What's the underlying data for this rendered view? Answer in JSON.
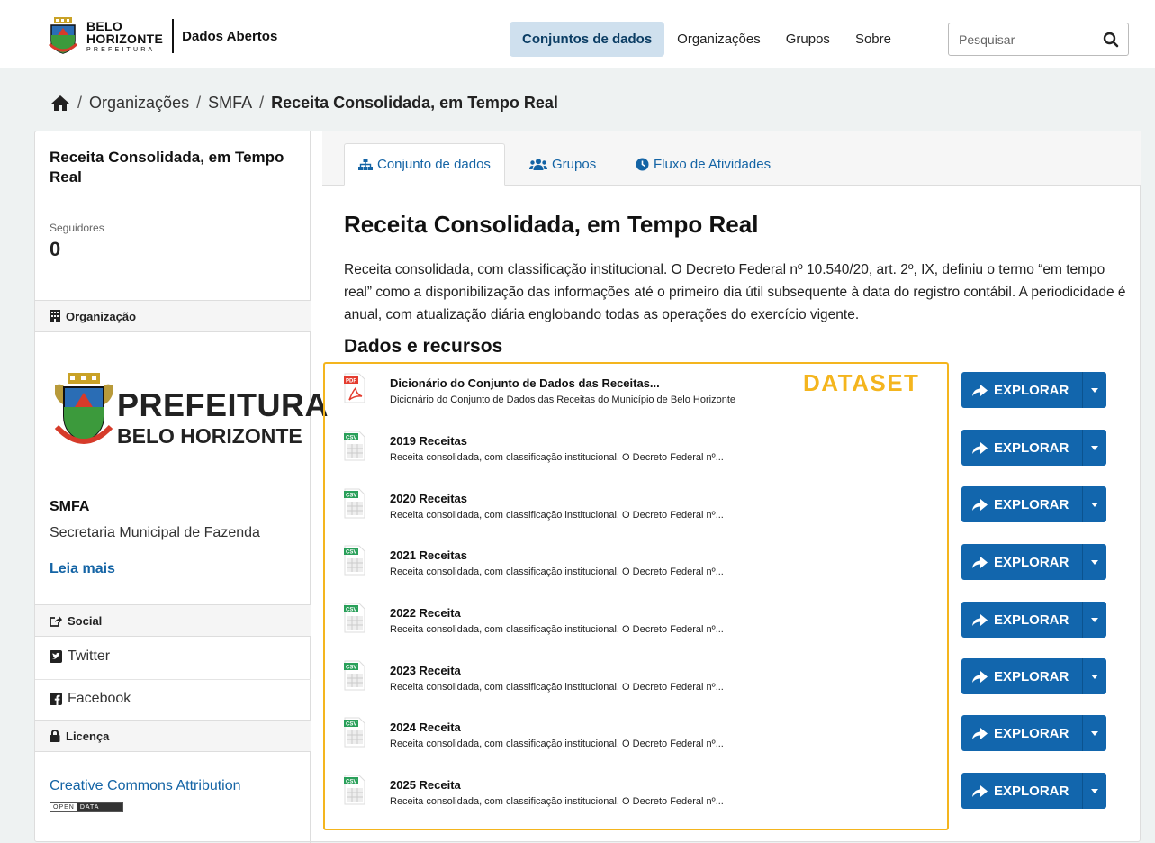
{
  "header": {
    "logo_line1": "BELO",
    "logo_line2": "HORIZONTE",
    "logo_line3": "PREFEITURA",
    "logo_sub": "Dados Abertos",
    "nav": [
      {
        "label": "Conjuntos de dados",
        "active": true
      },
      {
        "label": "Organizações"
      },
      {
        "label": "Grupos"
      },
      {
        "label": "Sobre"
      }
    ],
    "search_placeholder": "Pesquisar"
  },
  "breadcrumb": {
    "items": [
      "Organizações",
      "SMFA"
    ],
    "current": "Receita Consolidada, em Tempo Real",
    "sep": "/"
  },
  "sidebar": {
    "title": "Receita Consolidada, em Tempo Real",
    "followers_label": "Seguidores",
    "followers_count": "0",
    "org_section": "Organização",
    "org_logo_word1": "PREFEITURA",
    "org_logo_word2": "BELO HORIZONTE",
    "org_name": "SMFA",
    "org_desc": "Secretaria Municipal de Fazenda",
    "read_more": "Leia mais",
    "social_section": "Social",
    "twitter": "Twitter",
    "facebook": "Facebook",
    "license_section": "Licença",
    "license_link": "Creative Commons Attribution",
    "badge_open": "OPEN",
    "badge_data": "DATA"
  },
  "tabs": [
    {
      "label": "Conjunto de dados",
      "active": true
    },
    {
      "label": "Grupos"
    },
    {
      "label": "Fluxo de Atividades"
    }
  ],
  "dataset": {
    "title": "Receita Consolidada, em Tempo Real",
    "description": "Receita consolidada, com classificação institucional. O Decreto Federal nº 10.540/20, art. 2º, IX, definiu o termo “em tempo real” como a disponibilização das informações até o primeiro dia útil subsequente à data do registro contábil. A periodicidade é anual, com atualização diária englobando todas as operações do exercício vigente.",
    "resources_heading": "Dados e recursos",
    "annotation": "DATASET",
    "explore_label": "EXPLORAR",
    "resources": [
      {
        "format": "PDF",
        "name": "Dicionário do Conjunto de Dados das Receitas...",
        "desc": "Dicionário do Conjunto de Dados das Receitas do Município de Belo Horizonte"
      },
      {
        "format": "CSV",
        "name": "2019 Receitas",
        "desc": "Receita consolidada, com classificação institucional. O Decreto Federal nº..."
      },
      {
        "format": "CSV",
        "name": "2020 Receitas",
        "desc": "Receita consolidada, com classificação institucional. O Decreto Federal nº..."
      },
      {
        "format": "CSV",
        "name": "2021 Receitas",
        "desc": "Receita consolidada, com classificação institucional. O Decreto Federal nº..."
      },
      {
        "format": "CSV",
        "name": "2022 Receita",
        "desc": "Receita consolidada, com classificação institucional. O Decreto Federal nº..."
      },
      {
        "format": "CSV",
        "name": "2023 Receita",
        "desc": "Receita consolidada, com classificação institucional. O Decreto Federal nº..."
      },
      {
        "format": "CSV",
        "name": "2024 Receita",
        "desc": "Receita consolidada, com classificação institucional. O Decreto Federal nº..."
      },
      {
        "format": "CSV",
        "name": "2025 Receita",
        "desc": "Receita consolidada, com classificação institucional. O Decreto Federal nº..."
      }
    ]
  },
  "colors": {
    "accent": "#1266ad",
    "link": "#1464a5",
    "annotation": "#f4b51e",
    "nav_active_bg": "#cfe0ee"
  }
}
